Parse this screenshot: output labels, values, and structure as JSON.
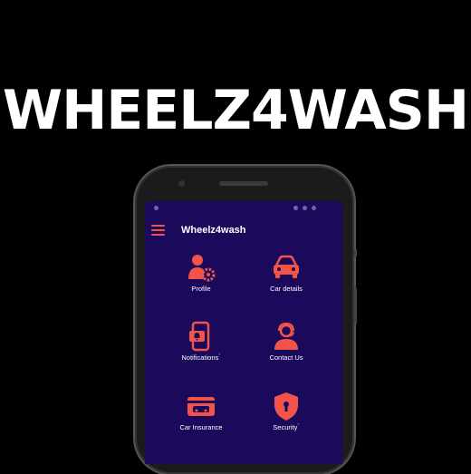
{
  "banner": {
    "title": "WHEELZ4WASH"
  },
  "app": {
    "title": "Wheelz4wash",
    "accent": "#f2544a",
    "background": "#1b0a5c"
  },
  "tiles": [
    {
      "label": "Profile",
      "icon": "profile-gear-icon"
    },
    {
      "label": "Car details",
      "icon": "car-icon"
    },
    {
      "label": "Notifications",
      "icon": "notification-phone-icon",
      "marker": "*"
    },
    {
      "label": "Contact Us",
      "icon": "support-agent-icon"
    },
    {
      "label": "Car Insurance",
      "icon": "insurance-card-icon"
    },
    {
      "label": "Security",
      "icon": "shield-lock-icon",
      "marker": "*"
    }
  ]
}
